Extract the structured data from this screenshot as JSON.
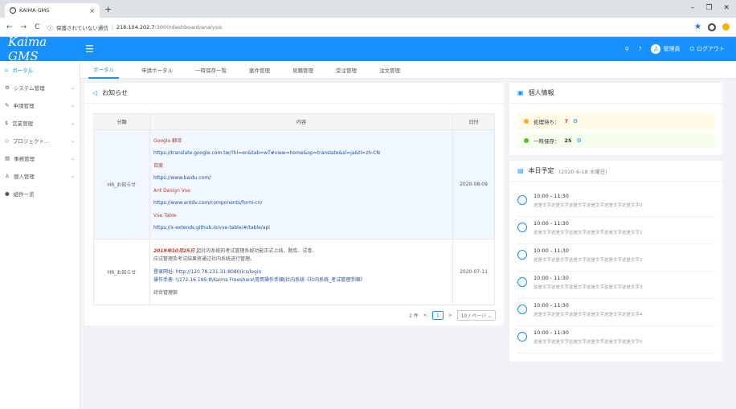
{
  "browser": {
    "tab_title": "KAIMA GMS",
    "tab_close": "×",
    "new_tab": "+",
    "url_security": "保護されていない通信",
    "url_host": "218.104.202.7",
    "url_path": ":3000/dashboard/analysis"
  },
  "header": {
    "logo": "Kaima GMS",
    "user": "管理員",
    "logout": "ログアウト"
  },
  "sidebar": {
    "items": [
      {
        "label": "ポータル",
        "icon": "home-icon",
        "glyph": "⌂",
        "chevron": false
      },
      {
        "label": "システム管理",
        "icon": "settings-icon",
        "glyph": "⚙",
        "chevron": true
      },
      {
        "label": "申請管理",
        "icon": "edit-icon",
        "glyph": "✎",
        "chevron": true
      },
      {
        "label": "営業管理",
        "icon": "sales-icon",
        "glyph": "$",
        "chevron": true
      },
      {
        "label": "プロジェクト...",
        "icon": "project-icon",
        "glyph": "◇",
        "chevron": true
      },
      {
        "label": "事務管理",
        "icon": "office-icon",
        "glyph": "▤",
        "chevron": true
      },
      {
        "label": "個人管理",
        "icon": "user-icon",
        "glyph": "♙",
        "chevron": true
      },
      {
        "label": "組件一览",
        "icon": "github-icon",
        "glyph": "●",
        "chevron": false
      }
    ]
  },
  "topnav": {
    "tabs": [
      "ポータル",
      "申請ボータル",
      "一時保存一覧",
      "案件管理",
      "見積管理",
      "受注管理",
      "注文管理"
    ]
  },
  "notice": {
    "title": "お知らせ",
    "col_category": "分類",
    "col_content": "内容",
    "col_date": "日付",
    "rows": [
      {
        "category": "HR_お知らせ",
        "date": "2020-08-09",
        "lines": [
          "Google 翻译",
          "https://translate.google.com.tw/?hl=en&tab=wT#view=home&op=translate&sl=ja&tl=zh-CN",
          "百度",
          "https://www.baidu.com/",
          "Ant Design Vue",
          "https://www.antdv.com/components/form-cn/",
          "Vxe.Table",
          "https://x-extends.github.io/vxe-table/#/table/api"
        ]
      },
      {
        "category": "HR_お知らせ",
        "date": "2020-07-11",
        "lead": "2019年10月25日",
        "line1": "起社内系统的考试管理系统功能正式上线，题库、试卷、",
        "line2": "应试管理及考试结果将通过社内系统进行管理。",
        "line3": "登录网址: http://120.78.231.31:8080/ics/login",
        "line4": "操作手册: \\\\172.16.195.8\\Kaima Freeshare\\常用操作手順\\社内系统《社内系统_考试管理手順》",
        "line5": "综合管理部"
      }
    ],
    "pager_total": "2 件",
    "pager_prev": "<",
    "pager_page": "1",
    "pager_next": ">",
    "pager_size": "10 / ページ"
  },
  "personal": {
    "title": "個人情報",
    "pending_label": "処理待ち：",
    "pending_count": "7",
    "draft_label": "一時保存：",
    "draft_count": "25"
  },
  "schedule": {
    "title": "本日予定",
    "date": "(2020-6-18 木曜日)",
    "items": [
      {
        "time": "10:00 - 11:30",
        "desc": "这是文字这是文字这是文字这是文字这是文字这是文字0"
      },
      {
        "time": "10:00 - 11:30",
        "desc": "这是文字这是文字这是文字这是文字这是文字这是文字1"
      },
      {
        "time": "10:00 - 11:30",
        "desc": "这是文字这是文字这是文字这是文字这是文字这是文字2"
      },
      {
        "time": "10:00 - 11:30",
        "desc": "这是文字这是文字这是文字这是文字这是文字这是文字3"
      },
      {
        "time": "10:00 - 11:30",
        "desc": "这是文字这是文字这是文字这是文字这是文字这是文字4"
      },
      {
        "time": "10:00 - 11:30",
        "desc": "这是文字这是文字这是文字这是文字这是文字这是文字5"
      }
    ]
  },
  "colors": {
    "primary": "#1890ff",
    "accent_red": "#c0392b"
  }
}
